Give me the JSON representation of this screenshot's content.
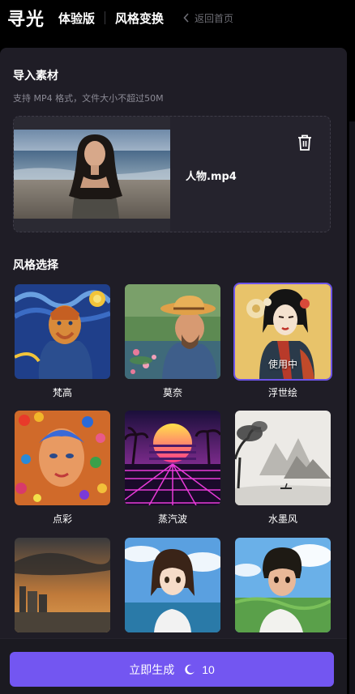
{
  "header": {
    "logo": "寻光",
    "edition": "体验版",
    "mode": "风格变换",
    "back_label": "返回首页"
  },
  "import": {
    "title": "导入素材",
    "hint": "支持 MP4 格式，文件大小不超过50M",
    "file_name": "人物.mp4"
  },
  "styles": {
    "title": "风格选择",
    "in_use_label": "使用中",
    "items": [
      {
        "label": "梵高",
        "selected": false
      },
      {
        "label": "莫奈",
        "selected": false
      },
      {
        "label": "浮世绘",
        "selected": true
      },
      {
        "label": "点彩",
        "selected": false
      },
      {
        "label": "蒸汽波",
        "selected": false
      },
      {
        "label": "水墨风",
        "selected": false
      },
      {
        "label": "",
        "selected": false
      },
      {
        "label": "",
        "selected": false
      },
      {
        "label": "",
        "selected": false
      }
    ]
  },
  "generate": {
    "label": "立即生成",
    "cost": "10"
  },
  "colors": {
    "accent": "#7356f1",
    "panel": "#1f1d26",
    "selected_border": "#6d54e8"
  }
}
